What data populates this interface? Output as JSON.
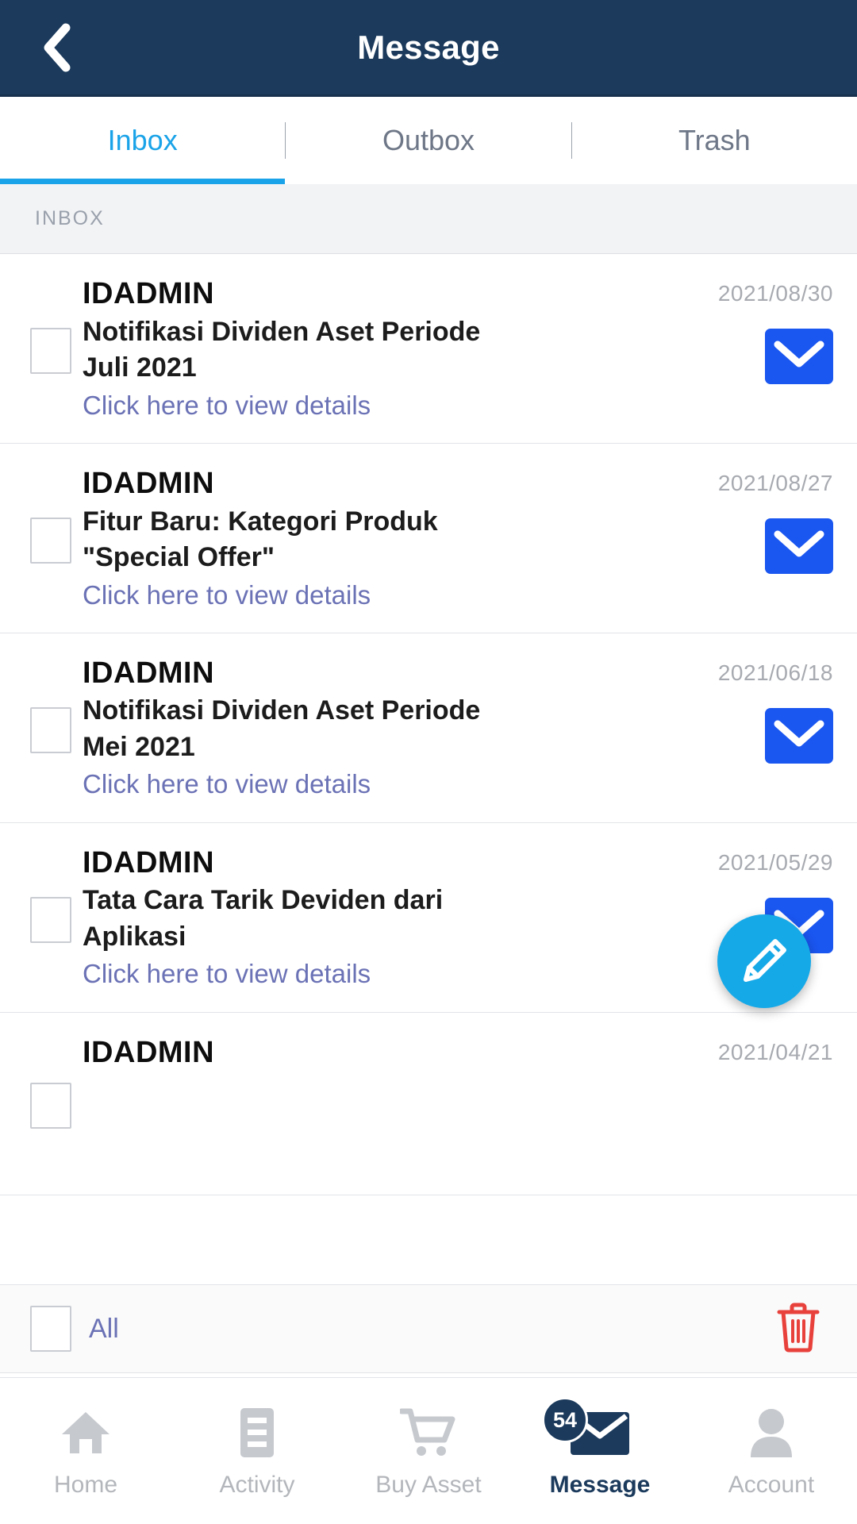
{
  "header": {
    "title": "Message",
    "back_icon": "chevron-left-icon",
    "bg_color": "#1b3a5c"
  },
  "tabs": {
    "active_color": "#1aa3e8",
    "items": [
      {
        "label": "Inbox",
        "active": true
      },
      {
        "label": "Outbox",
        "active": false
      },
      {
        "label": "Trash",
        "active": false
      }
    ]
  },
  "section": {
    "label": "INBOX"
  },
  "messages": [
    {
      "sender": "IDADMIN",
      "subject_line1": "Notifikasi Dividen Aset Periode",
      "subject_line2": "Juli 2021",
      "link": "Click here to view details",
      "date": "2021/08/30",
      "status_icon": "envelope-icon",
      "unread": true
    },
    {
      "sender": "IDADMIN",
      "subject_line1": "Fitur Baru: Kategori Produk",
      "subject_line2": "\"Special Offer\"",
      "link": "Click here to view details",
      "date": "2021/08/27",
      "status_icon": "envelope-icon",
      "unread": true
    },
    {
      "sender": "IDADMIN",
      "subject_line1": "Notifikasi Dividen Aset Periode",
      "subject_line2": "Mei 2021",
      "link": "Click here to view details",
      "date": "2021/06/18",
      "status_icon": "envelope-icon",
      "unread": true
    },
    {
      "sender": "IDADMIN",
      "subject_line1": "Tata Cara Tarik Deviden dari",
      "subject_line2": "Aplikasi",
      "link": "Click here to view details",
      "date": "2021/05/29",
      "status_icon": "envelope-icon",
      "unread": true
    },
    {
      "sender": "IDADMIN",
      "subject_line1": "",
      "subject_line2": "",
      "link": "",
      "date": "2021/04/21",
      "status_icon": "envelope-icon",
      "unread": true
    }
  ],
  "compose_fab": {
    "icon": "pencil-icon",
    "color": "#16a9e8"
  },
  "select_bar": {
    "label": "All",
    "delete_icon": "trash-icon",
    "delete_color": "#e8413c"
  },
  "bottom_nav": {
    "items": [
      {
        "label": "Home",
        "icon": "home-icon",
        "active": false,
        "badge": ""
      },
      {
        "label": "Activity",
        "icon": "list-icon",
        "active": false,
        "badge": ""
      },
      {
        "label": "Buy Asset",
        "icon": "cart-icon",
        "active": false,
        "badge": ""
      },
      {
        "label": "Message",
        "icon": "envelope-icon",
        "active": true,
        "badge": "54"
      },
      {
        "label": "Account",
        "icon": "user-icon",
        "active": false,
        "badge": ""
      }
    ]
  },
  "colors": {
    "header_navy": "#1b3a5c",
    "accent_cyan": "#1aa3e8",
    "envelope_blue": "#1a56f0",
    "link_slate": "#6b72b5",
    "trash_red": "#e8413c"
  }
}
